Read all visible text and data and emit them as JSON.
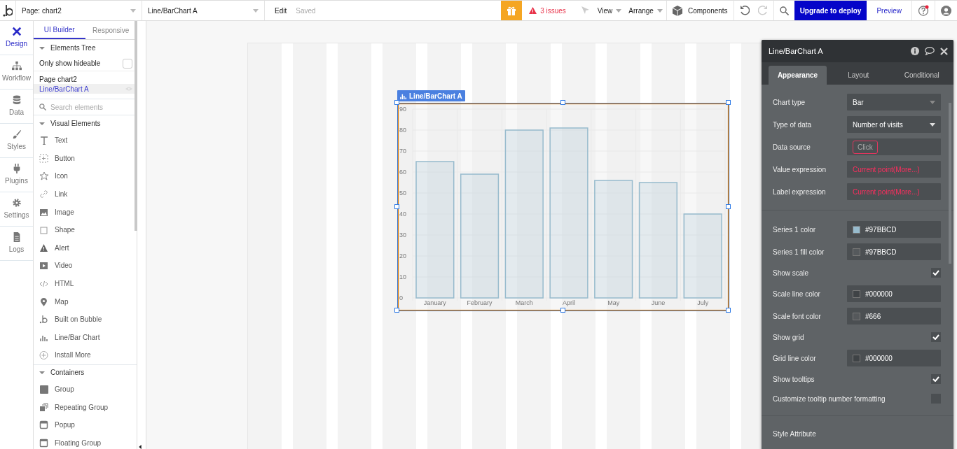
{
  "topbar": {
    "page_selector": "Page: chart2",
    "element_selector": "Line/BarChart A",
    "edit": "Edit",
    "saved": "Saved",
    "issues": "3 issues",
    "view": "View",
    "arrange": "Arrange",
    "components": "Components",
    "upgrade": "Upgrade to deploy",
    "preview": "Preview"
  },
  "rail": [
    {
      "label": "Design",
      "selected": true
    },
    {
      "label": "Workflow",
      "selected": false
    },
    {
      "label": "Data",
      "selected": false
    },
    {
      "label": "Styles",
      "selected": false
    },
    {
      "label": "Plugins",
      "selected": false
    },
    {
      "label": "Settings",
      "selected": false
    },
    {
      "label": "Logs",
      "selected": false
    }
  ],
  "sidebar": {
    "tabs": [
      {
        "label": "UI Builder",
        "selected": true
      },
      {
        "label": "Responsive",
        "selected": false
      }
    ],
    "elements_tree": {
      "title": "Elements Tree",
      "expanded": true
    },
    "only_hideable": {
      "label": "Only show hideable",
      "checked": false
    },
    "tree": [
      {
        "label": "Page chart2",
        "selected": false,
        "children": [
          {
            "label": "Line/BarChart A",
            "selected": true
          }
        ]
      }
    ],
    "search": {
      "placeholder": "Search elements"
    },
    "sections": [
      {
        "title": "Visual Elements",
        "expanded": true,
        "items": [
          "Text",
          "Button",
          "Icon",
          "Link",
          "Image",
          "Shape",
          "Alert",
          "Video",
          "HTML",
          "Map",
          "Built on Bubble",
          "Line/Bar Chart",
          "Install More"
        ]
      },
      {
        "title": "Containers",
        "expanded": true,
        "items": [
          "Group",
          "Repeating Group",
          "Popup",
          "Floating Group"
        ]
      }
    ]
  },
  "canvas": {
    "element_tag": "Line/BarChart A",
    "chart_data": {
      "type": "bar",
      "categories": [
        "January",
        "February",
        "March",
        "April",
        "May",
        "June",
        "July"
      ],
      "values": [
        65,
        59,
        80,
        81,
        56,
        55,
        40
      ],
      "grid": true,
      "ylim": [
        0,
        90
      ],
      "yticks": [
        0,
        10,
        20,
        30,
        40,
        50,
        60,
        70,
        80,
        90
      ]
    }
  },
  "panel": {
    "title": "Line/BarChart A",
    "tabs": [
      {
        "label": "Appearance",
        "selected": true
      },
      {
        "label": "Layout",
        "selected": false
      },
      {
        "label": "Conditional",
        "selected": false
      }
    ],
    "groups": [
      [
        {
          "kind": "select",
          "label": "Chart type",
          "value": "Bar"
        },
        {
          "kind": "select",
          "label": "Type of data",
          "value": "Number of visits"
        },
        {
          "kind": "button",
          "label": "Data source",
          "value": "Click"
        },
        {
          "kind": "expression",
          "label": "Value expression",
          "value": "Current point(More...)"
        },
        {
          "kind": "expression",
          "label": "Label expression",
          "value": "Current point(More...)"
        }
      ],
      [
        {
          "kind": "color",
          "label": "Series 1 color",
          "value": "#97BBCD",
          "color": "#97bbcd"
        },
        {
          "kind": "color",
          "label": "Series 1 fill color",
          "value": "#97BBCD",
          "color": "#55595c"
        },
        {
          "kind": "checkbox",
          "label": "Show scale",
          "checked": true
        },
        {
          "kind": "color",
          "label": "Scale line color",
          "value": "#000000",
          "color": "#3f4346"
        },
        {
          "kind": "color",
          "label": "Scale font color",
          "value": "#666",
          "color": "#55585b"
        },
        {
          "kind": "checkbox",
          "label": "Show grid",
          "checked": true
        },
        {
          "kind": "color",
          "label": "Grid line color",
          "value": "#000000",
          "color": "#3f4346"
        },
        {
          "kind": "checkbox",
          "label": "Show tooltips",
          "checked": true
        },
        {
          "kind": "checkbox",
          "label": "Customize tooltip number formatting",
          "checked": false
        }
      ],
      [
        {
          "kind": "heading",
          "label": "Style Attribute"
        }
      ]
    ]
  }
}
